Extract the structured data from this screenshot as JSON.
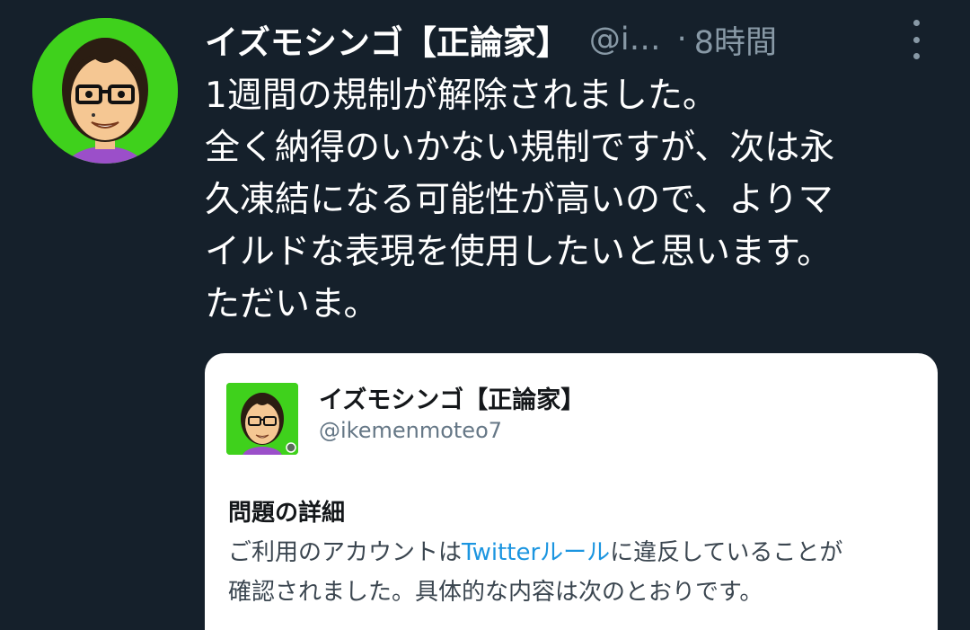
{
  "tweet": {
    "display_name": "イズモシンゴ【正論家】",
    "handle": "@i…",
    "separator": "·",
    "time": "8時間",
    "body_lines": [
      "1週間の規制が解除されました。",
      "全く納得のいかない規制ですが、次は永",
      "久凍結になる可能性が高いので、よりマ",
      "イルドな表現を使用したいと思います。",
      "ただいま。"
    ]
  },
  "card": {
    "display_name": "イズモシンゴ【正論家】",
    "handle": "@ikemenmoteo7",
    "heading": "問題の詳細",
    "line1_before": "ご利用のアカウントは",
    "line1_link": "Twitterルール",
    "line1_after": "に違反していることが",
    "line2": "確認されました。具体的な内容は次のとおりです。"
  },
  "icons": {
    "avatar": "mii-avatar-with-glasses",
    "more": "vertical-ellipsis-icon"
  },
  "colors": {
    "background": "#15202b",
    "text_primary": "#ffffff",
    "text_secondary": "#8899a6",
    "avatar_bg": "#3fd11c",
    "link": "#1b95e0",
    "card_bg": "#ffffff"
  }
}
